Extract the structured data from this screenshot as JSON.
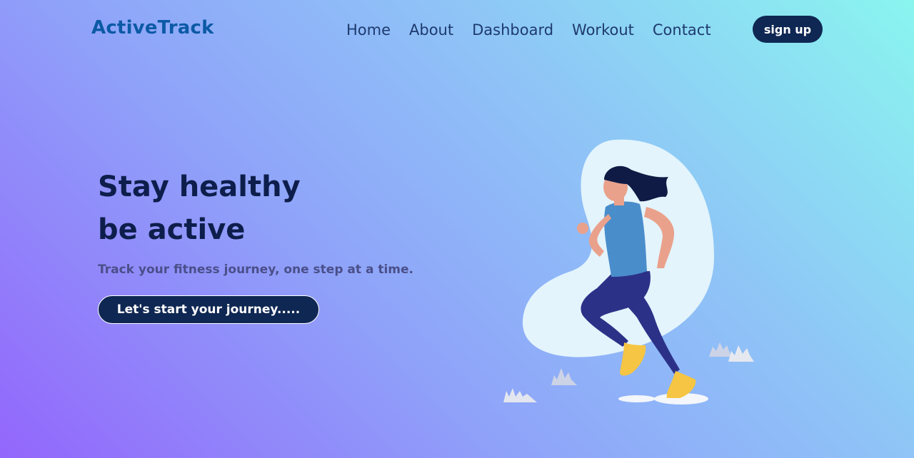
{
  "brand": {
    "name": "ActiveTrack",
    "color": "#0c5aa6"
  },
  "nav": {
    "links": [
      "Home",
      "About",
      "Dashboard",
      "Workout",
      "Contact"
    ],
    "signup_label": "sign up"
  },
  "hero": {
    "title_line1": "Stay healthy",
    "title_line2": "be active",
    "subtitle": "Track your fitness journey, one step at a time.",
    "cta_label": "Let's start your journey....."
  },
  "illustration": {
    "name": "running-woman-illustration"
  },
  "colors": {
    "button_bg": "#0f2753",
    "heading": "#0e1e4c",
    "gradient_start": "#8af5ef",
    "gradient_end": "#9366fc"
  }
}
